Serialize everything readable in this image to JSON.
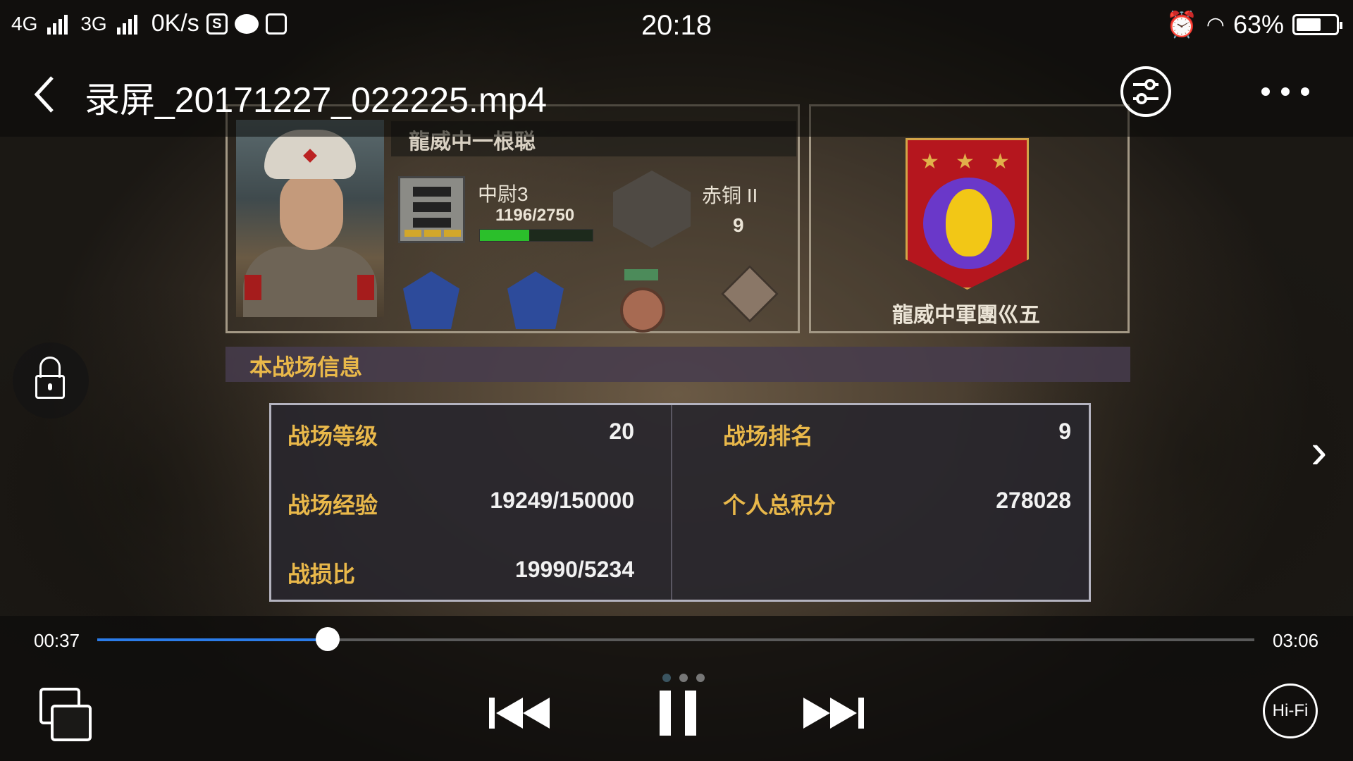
{
  "status_bar": {
    "net1": "4G",
    "net2": "3G",
    "speed": "0K/s",
    "s_icon": "S",
    "time": "20:18",
    "battery_pct": "63%",
    "battery_level": 0.63
  },
  "header": {
    "title": "录屏_20171227_022225.mp4",
    "icons": [
      "back-icon",
      "share-icon",
      "more-icon"
    ]
  },
  "video": {
    "player_name": "龍威中一根聪",
    "rank_name": "中尉3",
    "rank_xp": "1196/2750",
    "rank_progress": 0.435,
    "tier_name": "赤铜 II",
    "tier_num": "9",
    "legion_name": "龍威中軍團巛五",
    "section_title": "本战场信息",
    "stats": {
      "level_label": "战场等级",
      "level_value": "20",
      "rank_label": "战场排名",
      "rank_value": "9",
      "exp_label": "战场经验",
      "exp_value": "19249/150000",
      "score_label": "个人总积分",
      "score_value": "278028",
      "kd_label": "战损比",
      "kd_value": "19990/5234"
    }
  },
  "player": {
    "elapsed": "00:37",
    "duration": "03:06",
    "progress": 0.199,
    "hifi_label": "Hi-Fi",
    "accent": "#2b7ce9"
  }
}
